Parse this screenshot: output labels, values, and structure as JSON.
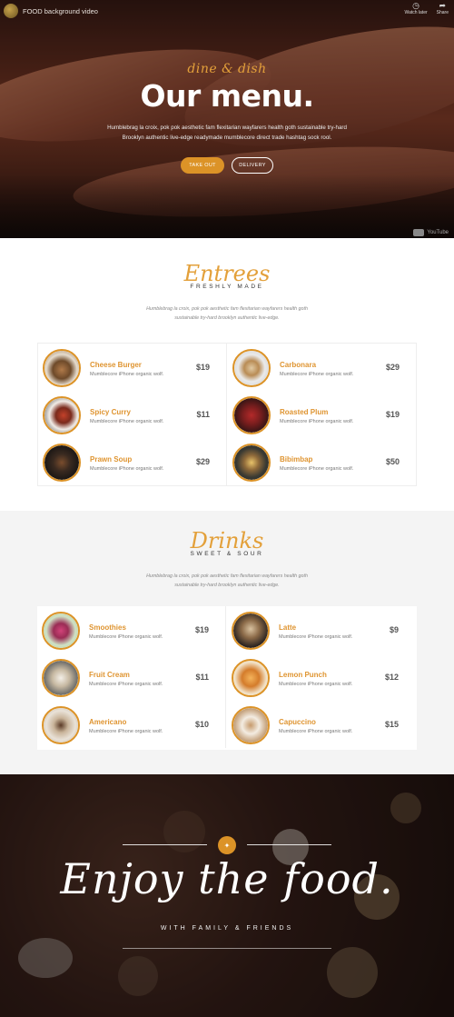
{
  "video_bar": {
    "title": "FOOD background video",
    "watch_later": "Watch later",
    "share": "Share",
    "brand": "YouTube"
  },
  "hero": {
    "tagline": "dine & dish",
    "title": "Our menu.",
    "description": "Humblebrag la croix, pok pok aesthetic fam flexitarian wayfarers health goth sustainable try-hard Brooklyn authentic live-edge readymade mumblecore direct trade hashtag sock rool.",
    "btn_takeout": "TAKE OUT",
    "btn_delivery": "DELIVERY"
  },
  "entrees": {
    "title": "Entrees",
    "subtitle": "FRESHLY MADE",
    "description": "Humblebrag la croix, pok pok aesthetic fam flexitarian wayfarers health goth sustainable try-hard brooklyn authentic live-edge.",
    "items": [
      {
        "name": "Cheese Burger",
        "desc": "Mumblecore iPhone organic wolf.",
        "price": "$19"
      },
      {
        "name": "Spicy Curry",
        "desc": "Mumblecore iPhone organic wolf.",
        "price": "$11"
      },
      {
        "name": "Prawn Soup",
        "desc": "Mumblecore iPhone organic wolf.",
        "price": "$29"
      },
      {
        "name": "Carbonara",
        "desc": "Mumblecore iPhone organic wolf.",
        "price": "$29"
      },
      {
        "name": "Roasted Plum",
        "desc": "Mumblecore iPhone organic wolf.",
        "price": "$19"
      },
      {
        "name": "Bibimbap",
        "desc": "Mumblecore iPhone organic wolf.",
        "price": "$50"
      }
    ]
  },
  "drinks": {
    "title": "Drinks",
    "subtitle": "SWEET & SOUR",
    "description": "Humblebrag la croix, pok pok aesthetic fam flexitarian wayfarers health goth sustainable try-hard brooklyn authentic live-edge.",
    "items": [
      {
        "name": "Smoothies",
        "desc": "Mumblecore iPhone organic wolf.",
        "price": "$19"
      },
      {
        "name": "Fruit Cream",
        "desc": "Mumblecore iPhone organic wolf.",
        "price": "$11"
      },
      {
        "name": "Americano",
        "desc": "Mumblecore iPhone organic wolf.",
        "price": "$10"
      },
      {
        "name": "Latte",
        "desc": "Mumblecore iPhone organic wolf.",
        "price": "$9"
      },
      {
        "name": "Lemon Punch",
        "desc": "Mumblecore iPhone organic wolf.",
        "price": "$12"
      },
      {
        "name": "Capuccino",
        "desc": "Mumblecore iPhone organic wolf.",
        "price": "$15"
      }
    ]
  },
  "footer": {
    "title": "Enjoy the food.",
    "subtitle": "WITH FAMILY & FRIENDS"
  },
  "colors": {
    "accent": "#dc9327",
    "text_dark": "#333333"
  }
}
